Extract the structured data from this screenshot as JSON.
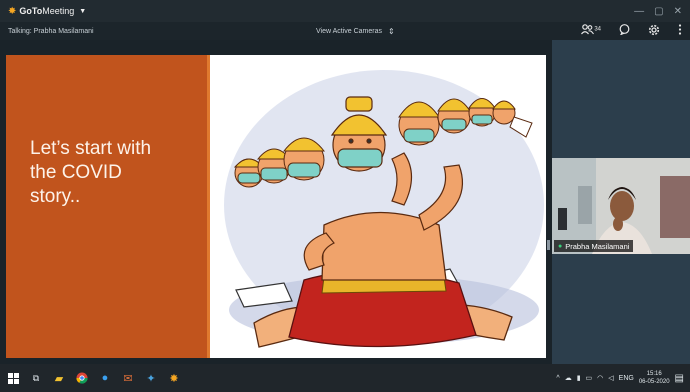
{
  "app": {
    "brand_go": "GoTo",
    "brand_rest": "Meeting",
    "window_controls": [
      "—",
      "▢",
      "✕"
    ]
  },
  "infobar": {
    "talking": "Talking: Prabha Masilamani",
    "view_active_cameras": "View Active Cameras",
    "attendee_count": "34"
  },
  "slide": {
    "text_lines": [
      "Let’s start with",
      "the COVID",
      "story.."
    ]
  },
  "webcam": {
    "name": "Prabha Masilamani"
  },
  "taskbar": {
    "lang": "ENG",
    "time": "15:16",
    "date": "06-05-2020"
  },
  "icons": {
    "logo": "starburst-icon",
    "attendees": "attendees-icon",
    "chat": "chat-icon",
    "settings": "gear-icon",
    "more": "more-vertical-icon"
  },
  "colors": {
    "slide_left": "#c1541d",
    "sidebar": "#2c3e4c",
    "titlebar": "#222b31"
  }
}
